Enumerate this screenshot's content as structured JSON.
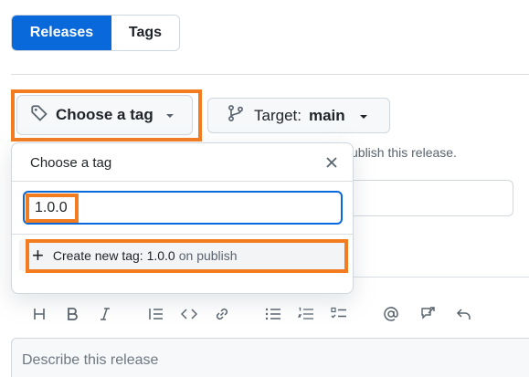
{
  "nav": {
    "tabs": [
      "Releases",
      "Tags"
    ],
    "active": "Releases"
  },
  "tag_button": {
    "label": "Choose a tag"
  },
  "target_button": {
    "label": "Target:",
    "value": "main"
  },
  "hint_text": "ublish this release.",
  "dropdown": {
    "title": "Choose a tag",
    "search_value": "1.0.0",
    "create_label": "Create new tag: 1.0.0",
    "create_suffix": "on publish"
  },
  "toolbar": {
    "buttons": [
      "heading",
      "bold",
      "italic",
      "quote",
      "code",
      "link",
      "unordered-list",
      "ordered-list",
      "task-list",
      "mention",
      "reference",
      "undo"
    ]
  },
  "description": {
    "placeholder": "Describe this release"
  },
  "colors": {
    "primary": "#0969da",
    "highlight": "#f47c20",
    "border": "#d0d7de",
    "muted": "#59636e"
  }
}
